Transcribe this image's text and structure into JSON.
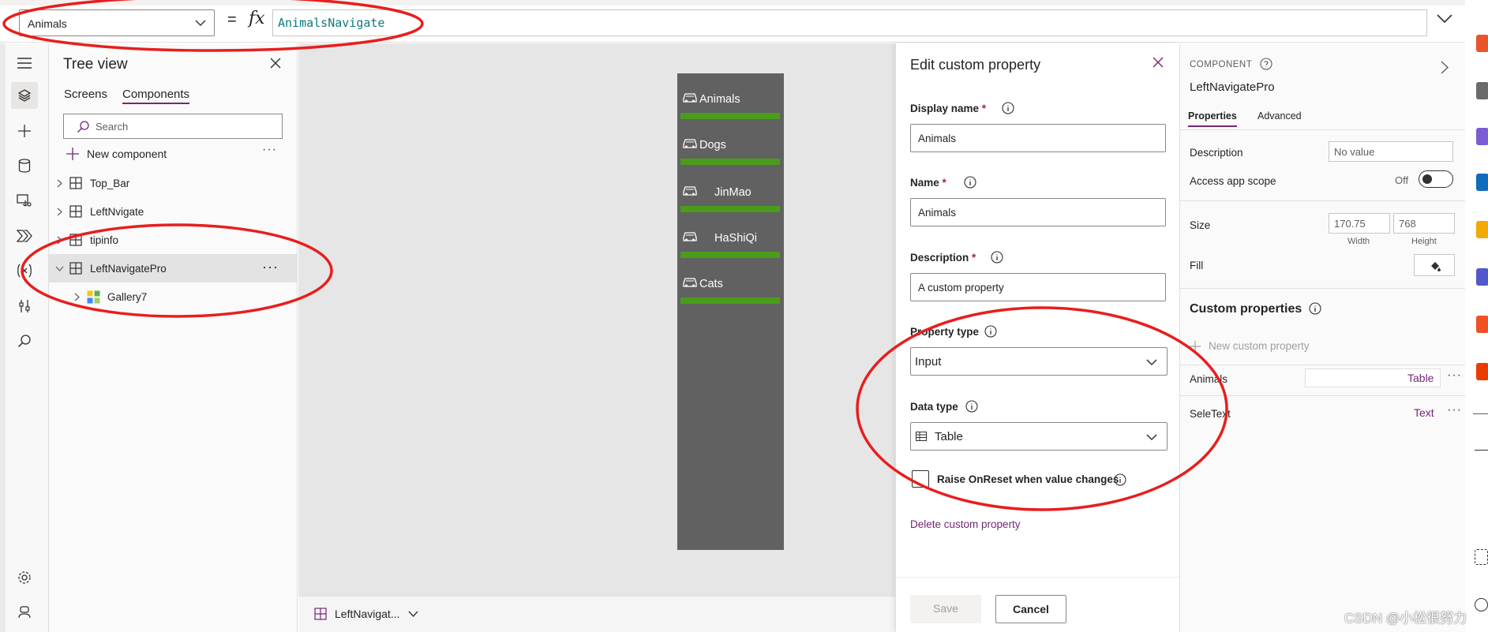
{
  "formula_bar": {
    "property": "Animals",
    "equals": "=",
    "fx": "fx",
    "formula": "AnimalsNavigate"
  },
  "tree_view": {
    "title": "Tree view",
    "tabs": [
      "Screens",
      "Components"
    ],
    "active_tab": "Components",
    "search_placeholder": "Search",
    "new_component": "New component",
    "more": "···",
    "items": [
      {
        "label": "Top_Bar"
      },
      {
        "label": "LeftNvigate"
      },
      {
        "label": "tipinfo"
      },
      {
        "label": "LeftNavigatePro",
        "selected": true
      },
      {
        "label": "Gallery7",
        "child": true
      }
    ]
  },
  "canvas": {
    "nav_items": [
      {
        "label": "Animals"
      },
      {
        "label": "Dogs"
      },
      {
        "label": "JinMao"
      },
      {
        "label": "HaShiQi"
      },
      {
        "label": "Cats"
      }
    ],
    "bar_color": "#4a9c1a",
    "preview_bg": "#616161",
    "footer_selected": "LeftNavigat..."
  },
  "edit_panel": {
    "title": "Edit custom property",
    "display_name_label": "Display name",
    "display_name_value": "Animals",
    "name_label": "Name",
    "name_value": "Animals",
    "description_label": "Description",
    "description_value": "A custom property",
    "required_mark": "*",
    "property_type_label": "Property type",
    "property_type_value": "Input",
    "data_type_label": "Data type",
    "data_type_value": "Table",
    "raise_onreset_label": "Raise OnReset when value changes",
    "raise_onreset_checked": false,
    "delete_link": "Delete custom property",
    "save_label": "Save",
    "cancel_label": "Cancel"
  },
  "properties_panel": {
    "section": "COMPONENT",
    "component_name": "LeftNavigatePro",
    "tabs": [
      "Properties",
      "Advanced"
    ],
    "active_tab": "Properties",
    "description_label": "Description",
    "description_placeholder": "No value",
    "access_scope_label": "Access app scope",
    "access_scope_state": "Off",
    "size_label": "Size",
    "width_value": "170.75",
    "height_value": "768",
    "width_caption": "Width",
    "height_caption": "Height",
    "fill_label": "Fill",
    "custom_properties_header": "Custom properties",
    "new_custom_property": "New custom property",
    "custom_properties": [
      {
        "name": "Animals",
        "type": "Table"
      },
      {
        "name": "SeleText",
        "type": "Text"
      }
    ],
    "more": "···"
  },
  "watermark": "CSDN @小松很努力",
  "accent_color": "#742774",
  "annotation_color": "#e81e1e"
}
